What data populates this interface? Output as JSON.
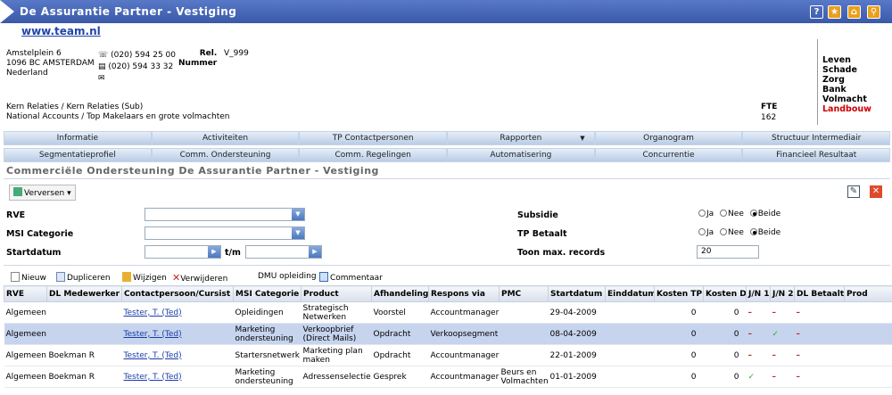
{
  "window": {
    "title": "De Assurantie Partner - Vestiging",
    "url": "www.team.nl"
  },
  "contact": {
    "address": [
      "Amstelplein 6",
      "1096 BC  AMSTERDAM",
      "Nederland"
    ],
    "phone": "(020) 594 25 00",
    "fax": "(020) 594 33 32",
    "rel_label": "Rel.",
    "nummer_label": "Nummer",
    "rel_value": "V_999"
  },
  "types": [
    {
      "label": "Leven",
      "color": "#000000"
    },
    {
      "label": "Schade",
      "color": "#000000"
    },
    {
      "label": "Zorg",
      "color": "#000000"
    },
    {
      "label": "Bank",
      "color": "#000000"
    },
    {
      "label": "Volmacht",
      "color": "#000000"
    },
    {
      "label": "Landbouw",
      "color": "#cc0000"
    }
  ],
  "relations": [
    "Kern Relaties / Kern Relaties (Sub)",
    "National Accounts / Top Makelaars en grote volmachten"
  ],
  "fte": {
    "label": "FTE",
    "value": "162"
  },
  "tabs_row1": [
    "Informatie",
    "Activiteiten",
    "TP Contactpersonen",
    "Rapporten",
    "Organogram",
    "Structuur Intermediair"
  ],
  "tabs_row2": [
    "Segmentatieprofiel",
    "Comm. Ondersteuning",
    "Comm. Regelingen",
    "Automatisering",
    "Concurrentie",
    "Financieel Resultaat"
  ],
  "section_title": "Commerciële Ondersteuning De Assurantie Partner - Vestiging",
  "refresh_label": "Verversen",
  "filters": {
    "rve_label": "RVE",
    "msi_label": "MSI Categorie",
    "start_label": "Startdatum",
    "tm_label": "t/m",
    "subsidie_label": "Subsidie",
    "tp_label": "TP Betaalt",
    "max_label": "Toon max. records",
    "max_value": "20",
    "ja": "Ja",
    "nee": "Nee",
    "beide": "Beide"
  },
  "toolbar": {
    "new": "Nieuw",
    "duplicate": "Dupliceren",
    "edit": "Wijzigen",
    "delete": "Verwijderen",
    "dmu": "DMU opleiding",
    "comment": "Commentaar"
  },
  "columns": [
    "RVE",
    "DL Medewerker",
    "Contactpersoon/Cursist",
    "MSI Categorie",
    "Product",
    "Afhandeling",
    "Respons via",
    "PMC",
    "Startdatum",
    "Einddatum",
    "Kosten TP",
    "Kosten DL",
    "J/N 1",
    "J/N 2",
    "DL Betaalt",
    "Prod"
  ],
  "rows": [
    {
      "rve": "Algemeen",
      "dl": "",
      "contact": "Tester, T. (Ted)",
      "msi": "Opleidingen",
      "product": "Strategisch Netwerken",
      "afh": "Voorstel",
      "respons": "Accountmanager",
      "pmc": "",
      "start": "29-04-2009",
      "eind": "",
      "ktp": "0",
      "kdl": "0",
      "jn1": "dash",
      "jn2": "dash",
      "dlb": "dash",
      "selected": false
    },
    {
      "rve": "Algemeen",
      "dl": "",
      "contact": "Tester, T. (Ted)",
      "msi": "Marketing ondersteuning",
      "product": "Verkoopbrief (Direct Mails)",
      "afh": "Opdracht",
      "respons": "Verkoopsegment",
      "pmc": "",
      "start": "08-04-2009",
      "eind": "",
      "ktp": "0",
      "kdl": "0",
      "jn1": "dash",
      "jn2": "check",
      "dlb": "dash",
      "selected": true
    },
    {
      "rve": "Algemeen",
      "dl": "Boekman R",
      "contact": "Tester, T. (Ted)",
      "msi": "Startersnetwerk",
      "product": "Marketing plan maken",
      "afh": "Opdracht",
      "respons": "Accountmanager",
      "pmc": "",
      "start": "22-01-2009",
      "eind": "",
      "ktp": "0",
      "kdl": "0",
      "jn1": "dash",
      "jn2": "dash",
      "dlb": "dash",
      "selected": false
    },
    {
      "rve": "Algemeen",
      "dl": "Boekman R",
      "contact": "Tester, T. (Ted)",
      "msi": "Marketing ondersteuning",
      "product": "Adressenselectie",
      "afh": "Gesprek",
      "respons": "Accountmanager",
      "pmc": "Beurs en Volmachten",
      "start": "01-01-2009",
      "eind": "",
      "ktp": "0",
      "kdl": "0",
      "jn1": "check",
      "jn2": "dash",
      "dlb": "dash",
      "selected": false
    }
  ]
}
